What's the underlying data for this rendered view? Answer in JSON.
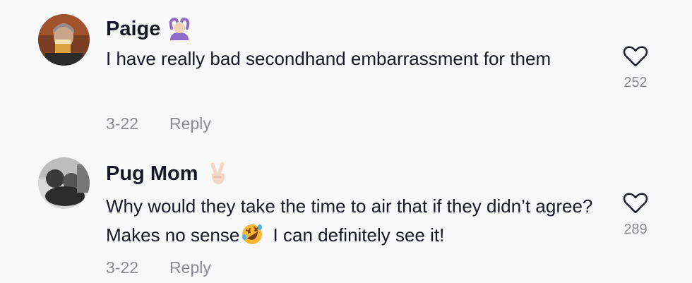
{
  "comments": [
    {
      "author": "Paige",
      "author_emoji": "person-gesturing-ok-emoji",
      "text": "I have really bad secondhand embarrassment for them",
      "date": "3-22",
      "reply_label": "Reply",
      "like_count": "252"
    },
    {
      "author": "Pug Mom",
      "author_emoji": "victory-hand-emoji",
      "text_before_emoji": "Why would they take the time to air that if they didn’t agree? Makes no sense",
      "inline_emoji": "rolling-on-floor-laughing-emoji",
      "text_after_emoji": "I can definitely see it!",
      "date": "3-22",
      "reply_label": "Reply",
      "like_count": "289"
    }
  ],
  "colors": {
    "background": "#f8f8f8",
    "text": "#161823",
    "meta": "#8a8b91"
  }
}
